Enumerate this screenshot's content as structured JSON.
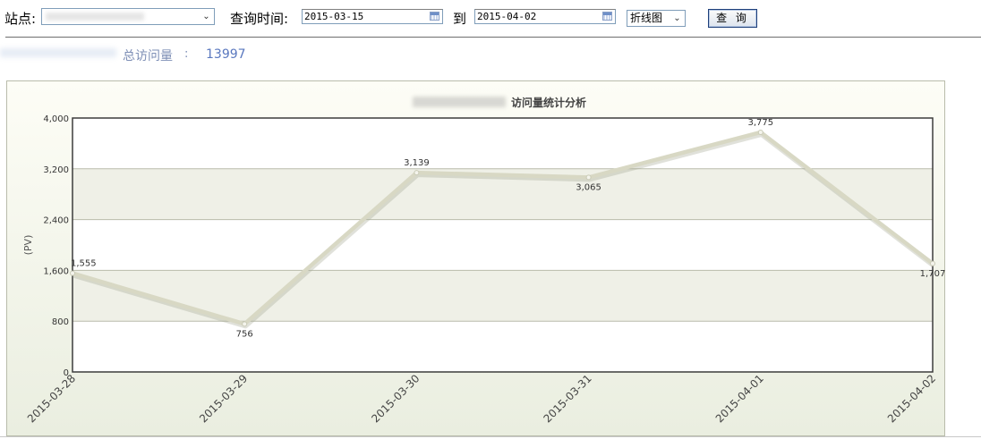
{
  "toolbar": {
    "site_label": "站点:",
    "query_time_label": "查询时间:",
    "start_date": "2015-03-15",
    "to_label": "到",
    "end_date": "2015-04-02",
    "chart_type": "折线图",
    "query_button": "查 询"
  },
  "summary": {
    "total_label": "总访问量",
    "colon": ":",
    "total_value": "13997"
  },
  "colors": {
    "line": "#d8d8c4",
    "axis_text": "#333333",
    "panel_border": "#b9bcab",
    "band": "#eff0e7"
  },
  "chart_data": {
    "type": "line",
    "title": "访问量统计分析",
    "ylabel": "(PV)",
    "xlabel": "",
    "ylim": [
      0,
      4000
    ],
    "yticks": [
      "0",
      "800",
      "1,600",
      "2,400",
      "3,200",
      "4,000"
    ],
    "ytick_values": [
      0,
      800,
      1600,
      2400,
      3200,
      4000
    ],
    "categories": [
      "2015-03-28",
      "2015-03-29",
      "2015-03-30",
      "2015-03-31",
      "2015-04-01",
      "2015-04-02"
    ],
    "series": [
      {
        "values": [
          1555,
          756,
          3139,
          3065,
          3775,
          1707
        ],
        "labels": [
          "1,555",
          "756",
          "3,139",
          "3,065",
          "3,775",
          "1,707"
        ]
      }
    ],
    "grid": true,
    "legend": "none"
  }
}
